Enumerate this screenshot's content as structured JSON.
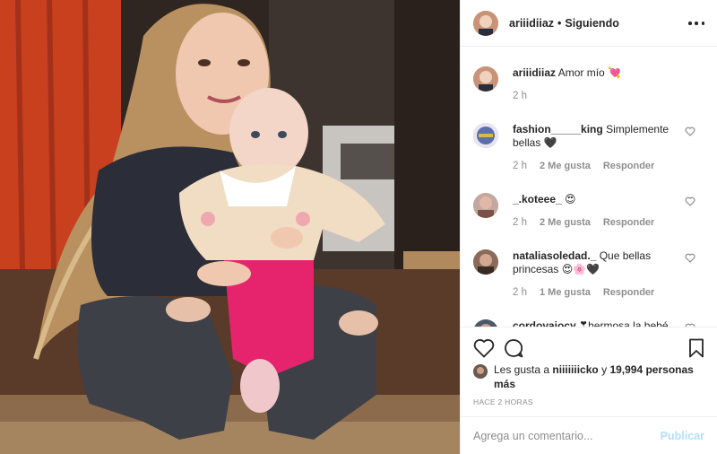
{
  "header": {
    "username": "ariiidiiaz",
    "separator": "•",
    "follow_status": "Siguiendo",
    "more_icon": "more-horizontal-icon"
  },
  "caption": {
    "username": "ariiidiiaz",
    "text": "Amor mío 💘",
    "time": "2 h"
  },
  "comments": [
    {
      "username": "fashion_____king",
      "text": "Simplemente bellas 🖤",
      "time": "2 h",
      "likes": "2 Me gusta",
      "reply": "Responder"
    },
    {
      "username": "_.koteee_",
      "text": "😍",
      "time": "2 h",
      "likes": "2 Me gusta",
      "reply": "Responder"
    },
    {
      "username": "nataliasoledad._",
      "text": "Que bellas princesas 😍🌸🖤",
      "time": "2 h",
      "likes": "1 Me gusta",
      "reply": "Responder"
    },
    {
      "username": "cordovajocy",
      "text": "❣hermosa la bebé",
      "time": "",
      "likes": "",
      "reply": ""
    }
  ],
  "actions": {
    "like_icon": "heart-icon",
    "comment_icon": "comment-icon",
    "save_icon": "bookmark-icon"
  },
  "likes": {
    "prefix": "Les gusta a",
    "user": "niiiiiiicko",
    "conj": "y",
    "others": "19,994 personas más"
  },
  "timestamp": "HACE 2 HORAS",
  "add_comment": {
    "placeholder": "Agrega un comentario...",
    "publish_label": "Publicar"
  },
  "colors": {
    "text": "#262626",
    "secondary": "#8e8e8e",
    "border": "#efefef",
    "publish_disabled": "#b2dffc"
  }
}
